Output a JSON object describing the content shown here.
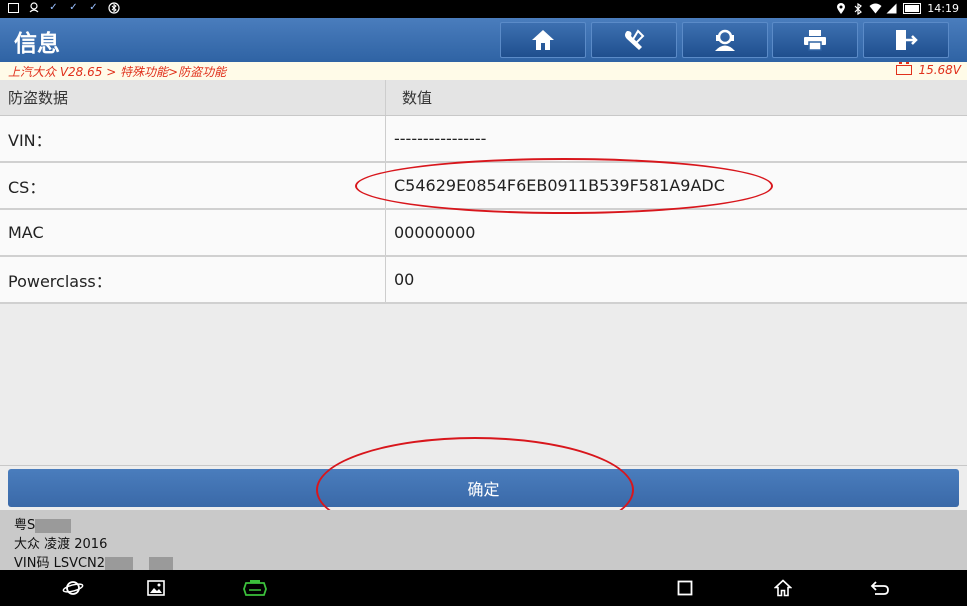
{
  "status_bar": {
    "time": "14:19",
    "left_icons": [
      "image-icon",
      "android-debug-icon",
      "check-icon",
      "check-icon",
      "check-icon",
      "bluetooth-settings-icon"
    ],
    "right_icons": [
      "location-icon",
      "bluetooth-icon",
      "wifi-icon",
      "signal-icon",
      "battery-icon"
    ]
  },
  "header": {
    "title": "信息",
    "toolbar": [
      "home-icon",
      "diagnostic-tools-icon",
      "support-agent-icon",
      "print-icon",
      "exit-icon"
    ]
  },
  "breadcrumb": {
    "path": "上汽大众 V28.65 > 特殊功能>防盗功能",
    "voltage": "15.68V"
  },
  "table": {
    "headers": [
      "防盗数据",
      "数值"
    ],
    "rows": [
      {
        "label": "VIN：",
        "value": "----------------"
      },
      {
        "label": "CS：",
        "value": "C54629E0854F6EB0911B539F581A9ADC"
      },
      {
        "label": "MAC",
        "value": "00000000"
      },
      {
        "label": "Powerclass：",
        "value": "00"
      }
    ]
  },
  "confirm_button": {
    "label": "确定"
  },
  "vehicle_info": {
    "plate": "粤S",
    "model": "大众 凌渡 2016",
    "vin": "VIN码 LSVCN2"
  },
  "nav_bar": [
    "browser-icon",
    "gallery-icon",
    "vci-icon",
    "recent-apps-icon",
    "home-icon",
    "back-icon"
  ],
  "colors": {
    "accent_blue": "#3a69a8",
    "highlight_red": "#d8161c",
    "breadcrumb_red": "#e0301b",
    "vci_green": "#3cc13c"
  }
}
